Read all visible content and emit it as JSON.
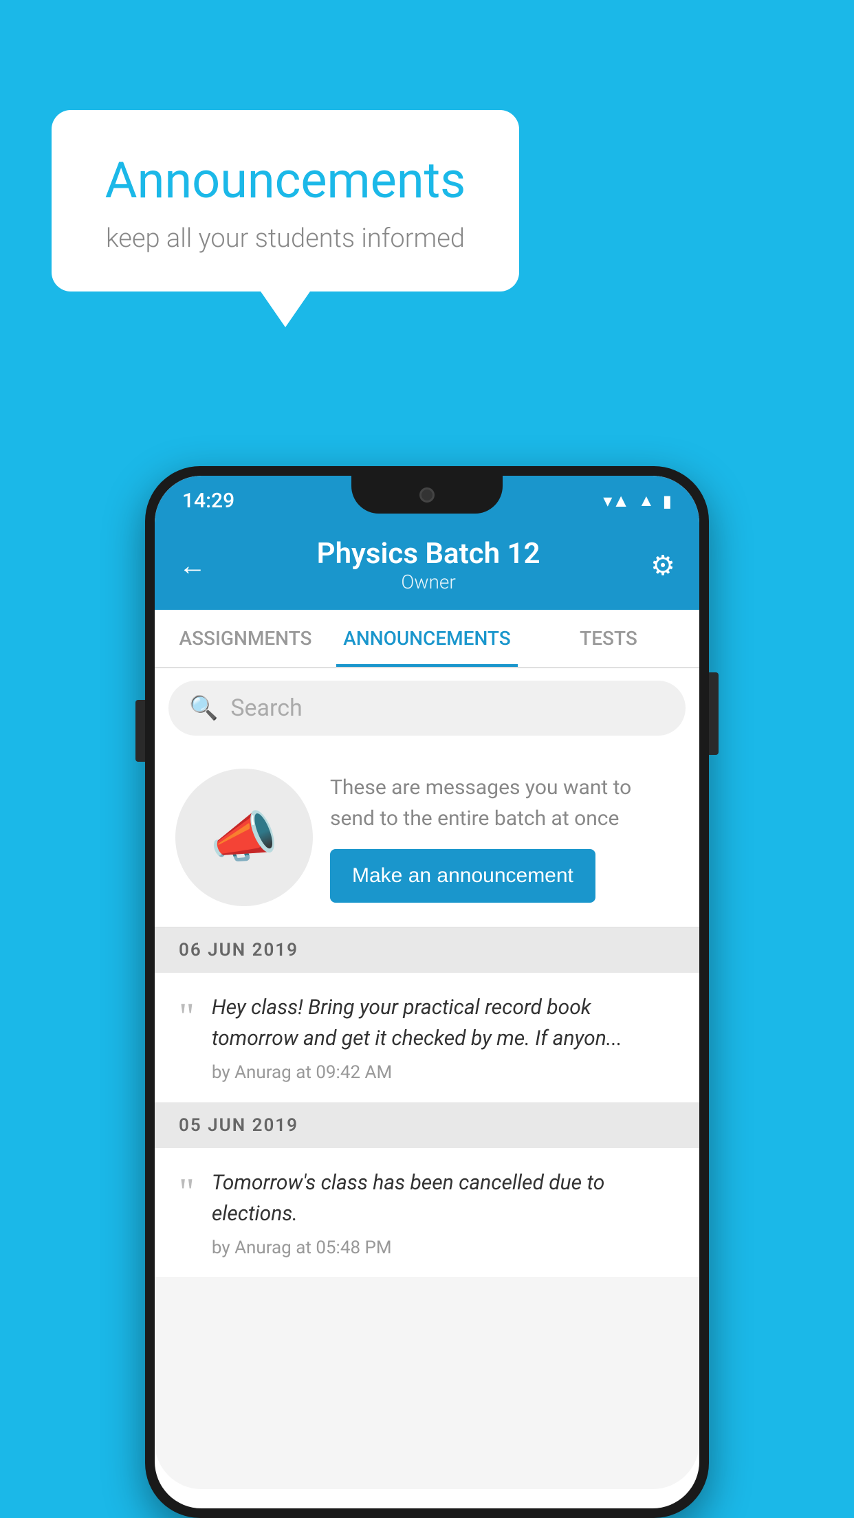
{
  "background_color": "#1BB8E8",
  "speech_bubble": {
    "title": "Announcements",
    "subtitle": "keep all your students informed"
  },
  "status_bar": {
    "time": "14:29",
    "icons": [
      "wifi",
      "signal",
      "battery"
    ]
  },
  "header": {
    "title": "Physics Batch 12",
    "subtitle": "Owner",
    "back_label": "←",
    "settings_label": "⚙"
  },
  "tabs": [
    {
      "label": "ASSIGNMENTS",
      "active": false
    },
    {
      "label": "ANNOUNCEMENTS",
      "active": true
    },
    {
      "label": "TESTS",
      "active": false
    },
    {
      "label": "...",
      "active": false
    }
  ],
  "search": {
    "placeholder": "Search"
  },
  "promo": {
    "text": "These are messages you want to send to the entire batch at once",
    "button_label": "Make an announcement"
  },
  "announcements": [
    {
      "date": "06  JUN  2019",
      "text": "Hey class! Bring your practical record book tomorrow and get it checked by me. If anyon...",
      "meta": "by Anurag at 09:42 AM"
    },
    {
      "date": "05  JUN  2019",
      "text": "Tomorrow's class has been cancelled due to elections.",
      "meta": "by Anurag at 05:48 PM"
    }
  ]
}
